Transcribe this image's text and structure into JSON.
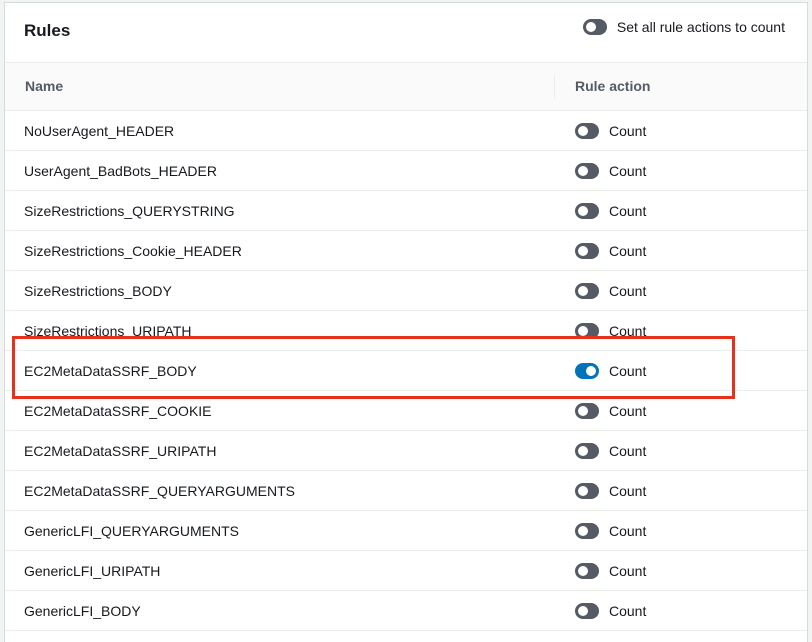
{
  "panel": {
    "title": "Rules",
    "set_all_label": "Set all rule actions to count",
    "set_all_on": false
  },
  "columns": {
    "name": "Name",
    "action": "Rule action"
  },
  "rules": [
    {
      "name": "NoUserAgent_HEADER",
      "action": "Count",
      "on": false
    },
    {
      "name": "UserAgent_BadBots_HEADER",
      "action": "Count",
      "on": false
    },
    {
      "name": "SizeRestrictions_QUERYSTRING",
      "action": "Count",
      "on": false
    },
    {
      "name": "SizeRestrictions_Cookie_HEADER",
      "action": "Count",
      "on": false
    },
    {
      "name": "SizeRestrictions_BODY",
      "action": "Count",
      "on": false
    },
    {
      "name": "SizeRestrictions_URIPATH",
      "action": "Count",
      "on": false
    },
    {
      "name": "EC2MetaDataSSRF_BODY",
      "action": "Count",
      "on": true
    },
    {
      "name": "EC2MetaDataSSRF_COOKIE",
      "action": "Count",
      "on": false
    },
    {
      "name": "EC2MetaDataSSRF_URIPATH",
      "action": "Count",
      "on": false
    },
    {
      "name": "EC2MetaDataSSRF_QUERYARGUMENTS",
      "action": "Count",
      "on": false
    },
    {
      "name": "GenericLFI_QUERYARGUMENTS",
      "action": "Count",
      "on": false
    },
    {
      "name": "GenericLFI_URIPATH",
      "action": "Count",
      "on": false
    },
    {
      "name": "GenericLFI_BODY",
      "action": "Count",
      "on": false
    }
  ],
  "colors": {
    "toggle_off": "#545b64",
    "toggle_on": "#0073bb",
    "highlight": "#e8311a"
  }
}
